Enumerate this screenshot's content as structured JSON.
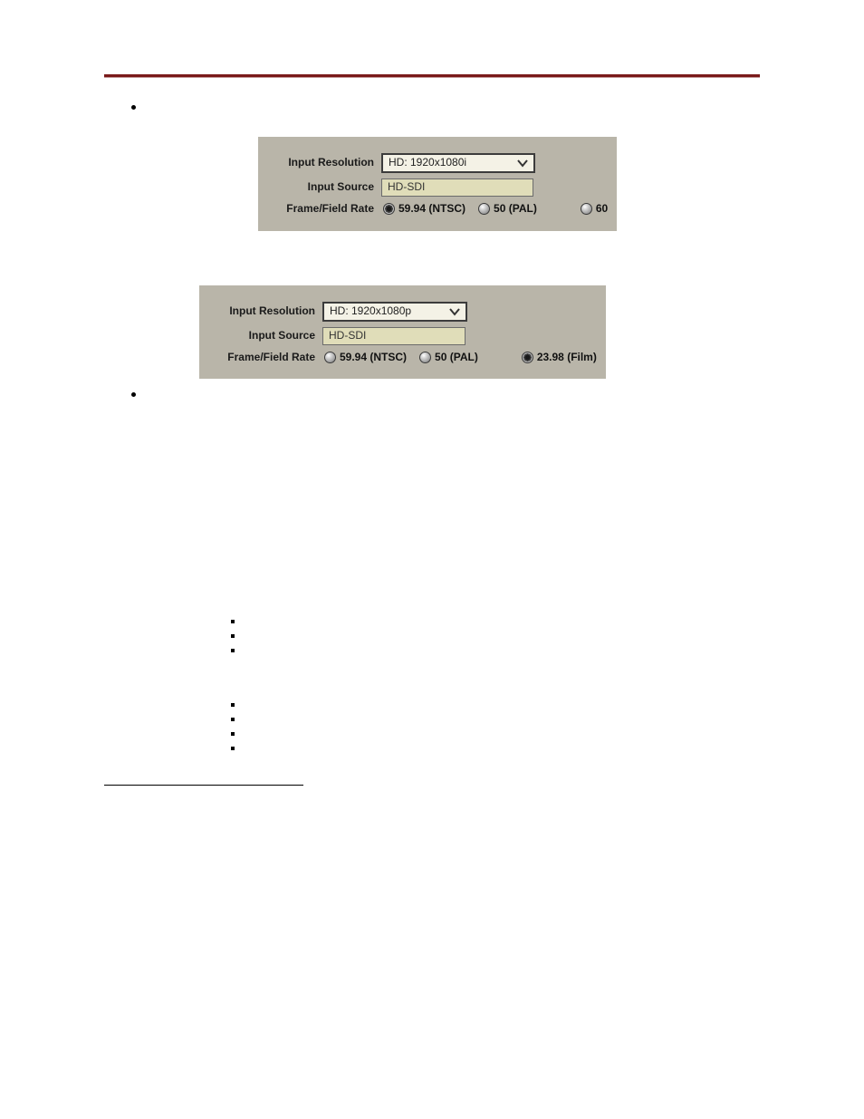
{
  "labels": {
    "input_resolution": "Input Resolution",
    "input_source": "Input Source",
    "frame_field_rate": "Frame/Field Rate"
  },
  "panel1": {
    "resolution": "HD: 1920x1080i",
    "source": "HD-SDI",
    "radios": {
      "ntsc": "59.94 (NTSC)",
      "pal": "50 (PAL)",
      "sixty": "60"
    }
  },
  "panel2": {
    "resolution": "HD: 1920x1080p",
    "source": "HD-SDI",
    "radios": {
      "ntsc": "59.94 (NTSC)",
      "pal": "50 (PAL)",
      "film": "23.98 (Film)"
    }
  }
}
